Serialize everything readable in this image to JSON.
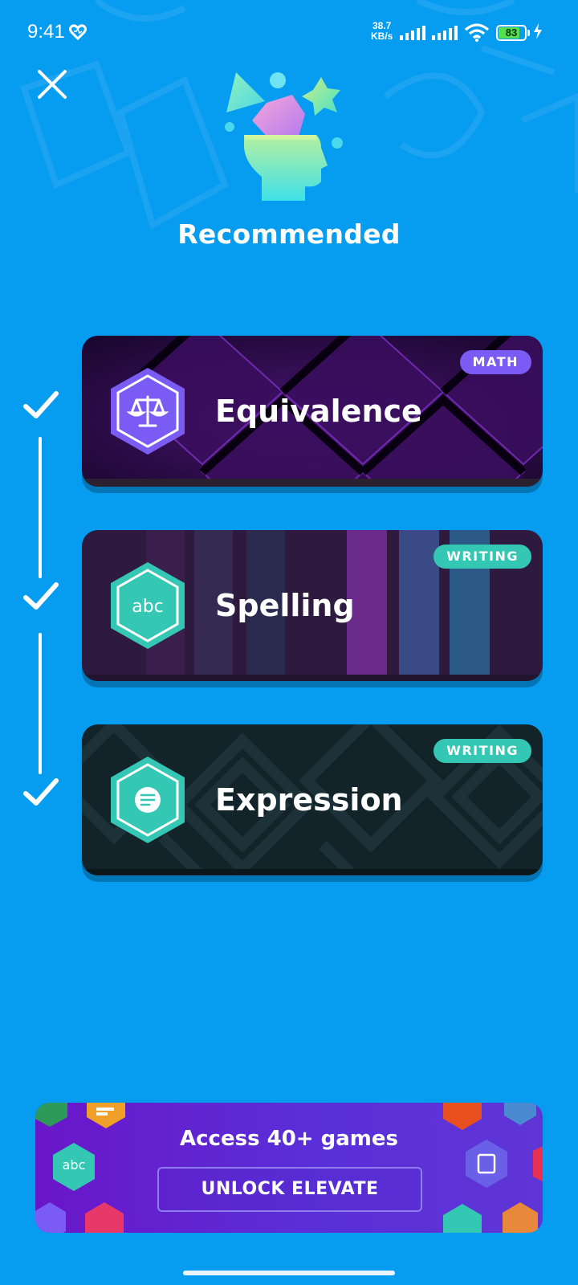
{
  "status_bar": {
    "time": "9:41",
    "net_speed_value": "38.7",
    "net_speed_unit": "KB/s",
    "battery": "83",
    "battery_level": 0.83
  },
  "header": {
    "title": "Recommended",
    "close_icon": "close-icon",
    "hero_icon": "brain-shapes-icon"
  },
  "games": [
    {
      "title": "Equivalence",
      "tag": "MATH",
      "icon": "scales-icon",
      "completed": true,
      "hex_color": "#7a5cf4"
    },
    {
      "title": "Spelling",
      "tag": "WRITING",
      "icon": "abc-icon",
      "icon_text": "abc",
      "completed": true,
      "hex_color": "#34c7b3"
    },
    {
      "title": "Expression",
      "tag": "WRITING",
      "icon": "text-lines-icon",
      "completed": true,
      "hex_color": "#34c7b3"
    }
  ],
  "promo": {
    "headline": "Access 40+ games",
    "button_label": "UNLOCK ELEVATE",
    "badge_abc": "abc"
  },
  "colors": {
    "background": "#069cf0",
    "math_accent": "#7a5cf4",
    "writing_accent": "#34c7b3"
  }
}
